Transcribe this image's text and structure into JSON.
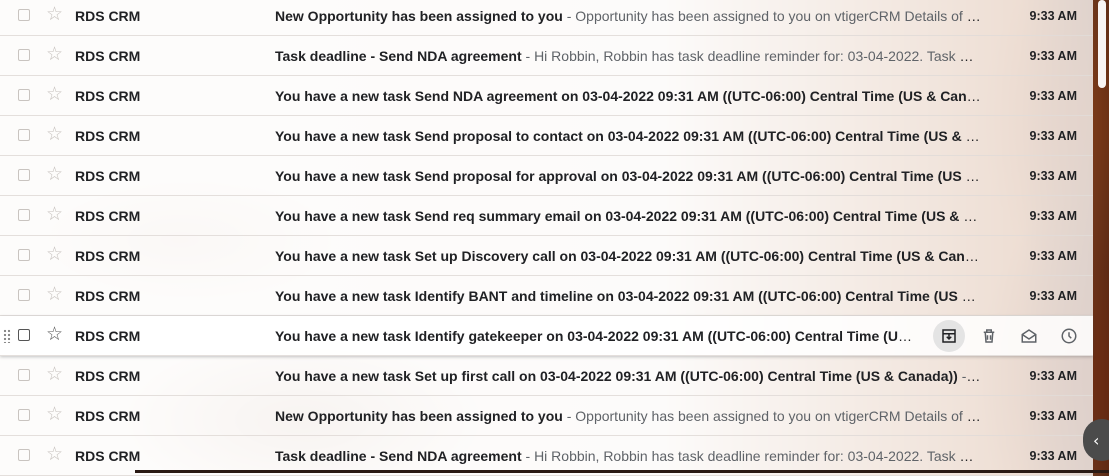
{
  "colors": {
    "accent": "#202124",
    "snippet": "#5f6368"
  },
  "emails": [
    {
      "sender": "RDS CRM",
      "subject": "New Opportunity has been assigned to you",
      "snippet": " - Opportunity has been assigned to you on vtigerCRM Details of Potential are :",
      "time": "9:33 AM"
    },
    {
      "sender": "RDS CRM",
      "subject": "Task deadline - Send NDA agreement",
      "snippet": " - Hi Robbin, Robbin has task deadline reminder for: 03-04-2022. Task Details",
      "time": "9:33 AM"
    },
    {
      "sender": "RDS CRM",
      "subject": "You have a new task Send NDA agreement on 03-04-2022 09:31 AM ((UTC-06:00) Central Time (US & Canada))",
      "snippet": "",
      "time": "9:33 AM"
    },
    {
      "sender": "RDS CRM",
      "subject": "You have a new task Send proposal to contact on 03-04-2022 09:31 AM ((UTC-06:00) Central Time (US & Canada))",
      "snippet": "",
      "time": "9:33 AM"
    },
    {
      "sender": "RDS CRM",
      "subject": "You have a new task Send proposal for approval on 03-04-2022 09:31 AM ((UTC-06:00) Central Time (US & Canada))",
      "snippet": "",
      "time": "9:33 AM"
    },
    {
      "sender": "RDS CRM",
      "subject": "You have a new task Send req summary email on 03-04-2022 09:31 AM ((UTC-06:00) Central Time (US & Canada))",
      "snippet": "",
      "time": "9:33 AM"
    },
    {
      "sender": "RDS CRM",
      "subject": "You have a new task Set up Discovery call on 03-04-2022 09:31 AM ((UTC-06:00) Central Time (US & Canada))",
      "snippet": "",
      "time": "9:33 AM"
    },
    {
      "sender": "RDS CRM",
      "subject": "You have a new task Identify BANT and timeline on 03-04-2022 09:31 AM ((UTC-06:00) Central Time (US & Canada))",
      "snippet": "",
      "time": "9:33 AM"
    },
    {
      "sender": "RDS CRM",
      "subject": "You have a new task Identify gatekeeper on 03-04-2022 09:31 AM ((UTC-06:00) Central Time (US & Canada))",
      "snippet": "",
      "time": "9:33 AM"
    },
    {
      "sender": "RDS CRM",
      "subject": "You have a new task Set up first call on 03-04-2022 09:31 AM ((UTC-06:00) Central Time (US & Canada))",
      "snippet": " - Hi",
      "time": "9:33 AM"
    },
    {
      "sender": "RDS CRM",
      "subject": "New Opportunity has been assigned to you",
      "snippet": " - Opportunity has been assigned to you on vtigerCRM Details of Potential are :",
      "time": "9:33 AM"
    },
    {
      "sender": "RDS CRM",
      "subject": "Task deadline - Send NDA agreement",
      "snippet": " - Hi Robbin, Robbin has task deadline reminder for: 03-04-2022. Task Details",
      "time": "9:33 AM"
    }
  ],
  "hover_row_index": 8,
  "hover_actions": [
    {
      "icon": "archive-icon"
    },
    {
      "icon": "trash-icon"
    },
    {
      "icon": "mark-read-icon"
    },
    {
      "icon": "snooze-icon"
    }
  ],
  "side_toggle_icon": "chevron-left-icon",
  "side_toggle_glyph": "‹"
}
